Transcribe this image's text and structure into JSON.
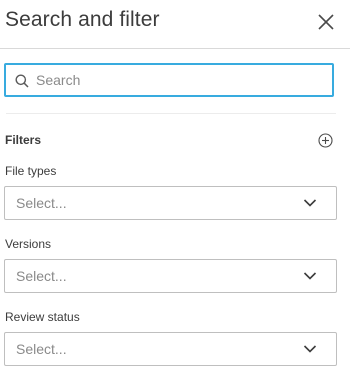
{
  "panel": {
    "title": "Search and filter",
    "close_icon": "close-icon"
  },
  "search": {
    "placeholder": "Search",
    "value": "",
    "icon": "search-icon",
    "accent_color": "#38abdf"
  },
  "filters": {
    "heading": "Filters",
    "add_icon": "plus-circle-icon",
    "fields": [
      {
        "label": "File types",
        "selected": "Select..."
      },
      {
        "label": "Versions",
        "selected": "Select..."
      },
      {
        "label": "Review status",
        "selected": "Select..."
      }
    ]
  }
}
